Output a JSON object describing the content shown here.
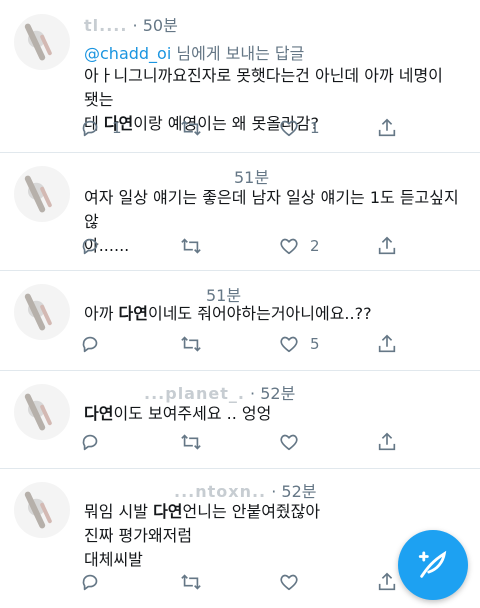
{
  "tweets": [
    {
      "name": "tl....",
      "time": "50분",
      "reply_prefix": "",
      "reply_handle": "@chadd_oi",
      "reply_suffix": " 님에게 보내는 답글",
      "lines": [
        [
          {
            "t": "아ㅏ니그니까요진자로 못햇다는건 아닌데 아까 네명이 됏는",
            "b": false
          }
        ],
        [
          {
            "t": "데 ",
            "b": false
          },
          {
            "t": "다연",
            "b": true
          },
          {
            "t": "이랑 예영이는 왜 못올라감?",
            "b": false
          }
        ]
      ],
      "reply_count": "1",
      "like_count": "1"
    },
    {
      "name": "",
      "time": "51분",
      "lines": [
        [
          {
            "t": "여자 일상 얘기는 좋은데 남자 일상 얘기는 1도 듣고싶지 않",
            "b": false
          }
        ],
        [
          {
            "t": "아......",
            "b": false
          }
        ]
      ],
      "reply_count": "",
      "like_count": "2"
    },
    {
      "name": "",
      "time": "51분",
      "lines": [
        [
          {
            "t": "아까 ",
            "b": false
          },
          {
            "t": "다연",
            "b": true
          },
          {
            "t": "이네도 줘어야하는거아니에요..??",
            "b": false
          }
        ]
      ],
      "reply_count": "",
      "like_count": "5"
    },
    {
      "name": "...planet_.",
      "time": "52분",
      "lines": [
        [
          {
            "t": "다연",
            "b": true
          },
          {
            "t": "이도 보여주세요 .. 엉엉",
            "b": false
          }
        ]
      ],
      "reply_count": "",
      "like_count": ""
    },
    {
      "name": "...ntoxn..",
      "time": "52분",
      "lines": [
        [
          {
            "t": "뭐임 시발 ",
            "b": false
          },
          {
            "t": "다연",
            "b": true
          },
          {
            "t": "언니는 안붙여줬잖아",
            "b": false
          }
        ],
        [
          {
            "t": "진짜 평가왜저럼",
            "b": false
          }
        ],
        [
          {
            "t": "대체씨발",
            "b": false
          }
        ]
      ],
      "reply_count": "",
      "like_count": ""
    }
  ],
  "icons": {
    "reply": "reply-icon",
    "retweet": "retweet-icon",
    "like": "heart-icon",
    "share": "share-icon",
    "compose": "compose-tweet-icon"
  },
  "colors": {
    "accent": "#1da1f2",
    "handle": "#1b95e0",
    "meta": "#657786",
    "divider": "#e1e8ed"
  }
}
